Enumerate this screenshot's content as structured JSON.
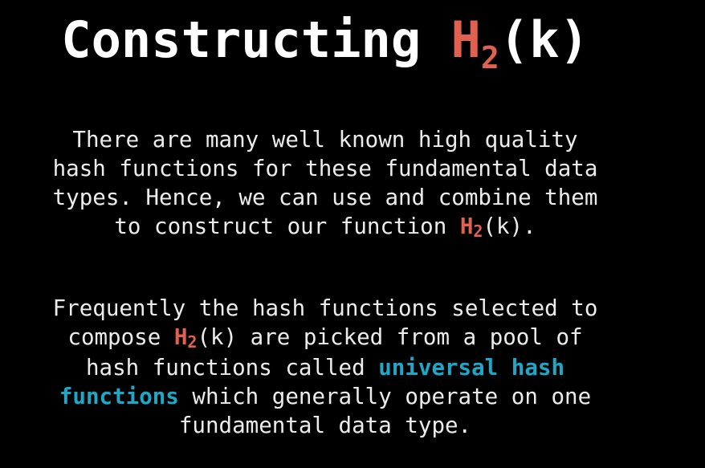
{
  "title": {
    "prefix": "Constructing ",
    "func_letter": "H",
    "func_sub": "2",
    "func_arg": "(k)"
  },
  "paragraph1": {
    "line1": "There are many well known high quality",
    "line2": "hash functions for these fundamental data",
    "line3": "types. Hence, we can use and combine them",
    "line4_prefix": "to construct our function ",
    "func_letter": "H",
    "func_sub": "2",
    "line4_suffix": "(k)."
  },
  "paragraph2": {
    "line1": "Frequently the hash functions selected to",
    "line2_prefix": "compose ",
    "func_letter": "H",
    "func_sub": "2",
    "line2_suffix": "(k) are picked from a pool of",
    "line3_prefix": "hash functions called ",
    "term_part1": "universal hash",
    "term_part2": "functions",
    "line4_suffix": " which generally operate on one",
    "line5": "fundamental data type."
  },
  "colors": {
    "background": "#000000",
    "text": "#ececec",
    "function_highlight": "#e0614f",
    "term_highlight": "#1fa7c7"
  }
}
